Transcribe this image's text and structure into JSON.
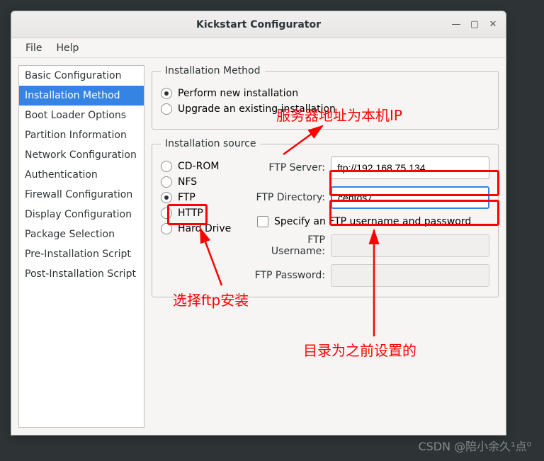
{
  "window": {
    "title": "Kickstart Configurator"
  },
  "menubar": {
    "file": "File",
    "help": "Help"
  },
  "sidebar": {
    "items": [
      "Basic Configuration",
      "Installation Method",
      "Boot Loader Options",
      "Partition Information",
      "Network Configuration",
      "Authentication",
      "Firewall Configuration",
      "Display Configuration",
      "Package Selection",
      "Pre-Installation Script",
      "Post-Installation Script"
    ],
    "selected_index": 1
  },
  "install_method": {
    "legend": "Installation Method",
    "new_install": "Perform new installation",
    "upgrade": "Upgrade an existing installation",
    "selected": "new_install"
  },
  "install_source": {
    "legend": "Installation source",
    "options": [
      "CD-ROM",
      "NFS",
      "FTP",
      "HTTP",
      "Hard Drive"
    ],
    "selected": "FTP",
    "ftp_server_label": "FTP Server:",
    "ftp_server_value": "ftp://192.168.75.134",
    "ftp_directory_label": "FTP Directory:",
    "ftp_directory_value": "centos7",
    "specify_creds_label": "Specify an FTP username and password",
    "specify_creds_checked": false,
    "ftp_username_label": "FTP Username:",
    "ftp_username_value": "",
    "ftp_password_label": "FTP Password:",
    "ftp_password_value": ""
  },
  "annotations": {
    "server_note": "服务器地址为本机IP",
    "ftp_note": "选择ftp安装",
    "dir_note": "目录为之前设置的"
  },
  "watermark": "CSDN @陪小余久¹点⁰"
}
